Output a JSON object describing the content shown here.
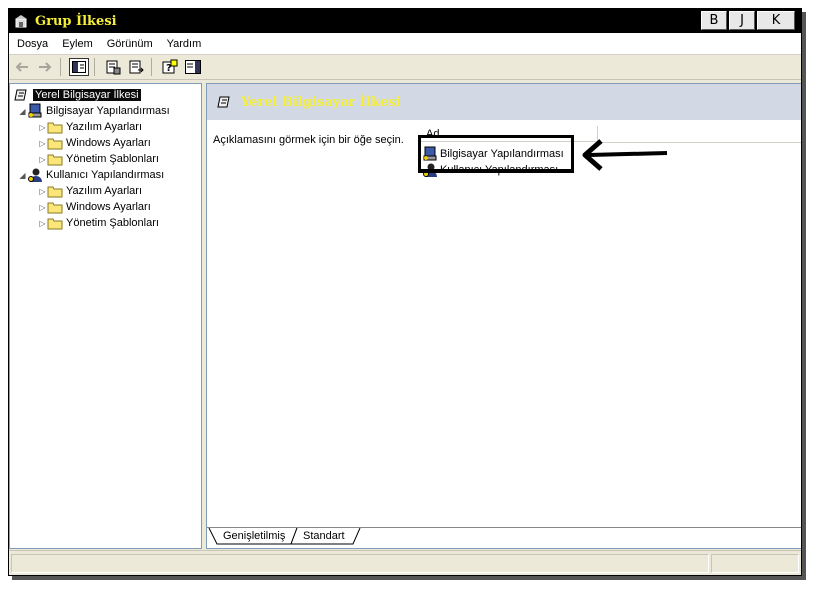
{
  "window": {
    "title": "Grup İlkesi"
  },
  "title_buttons": {
    "bold": "B",
    "italic": "J",
    "close": "K"
  },
  "menu": {
    "items": [
      "Dosya",
      "Eylem",
      "Görünüm",
      "Yardım"
    ]
  },
  "toolbar": {
    "icons": [
      "back-arrow-icon",
      "forward-arrow-icon",
      "show-hide-tree-icon",
      "properties-icon",
      "export-list-icon",
      "help-icon",
      "show-hide-action-pane-icon"
    ]
  },
  "tree": {
    "root": "Yerel Bilgisayar İlkesi",
    "computer_config": "Bilgisayar Yapılandırması",
    "user_config": "Kullanıcı Yapılandırması",
    "children": [
      "Yazılım Ayarları",
      "Windows Ayarları",
      "Yönetim Şablonları"
    ]
  },
  "right_pane": {
    "header_title": "Yerel Bilgisayar İlkesi",
    "description": "Açıklamasını görmek için bir öğe seçin.",
    "column_header": "Ad",
    "items": [
      "Bilgisayar Yapılandırması",
      "Kullanıcı Yapılandırması"
    ]
  },
  "tabs": [
    "Genişletilmiş",
    "Standart"
  ],
  "colors": {
    "title_text": "#f5ef3a",
    "titlebar_bg": "#000000",
    "header_band": "#d2d9e4"
  }
}
